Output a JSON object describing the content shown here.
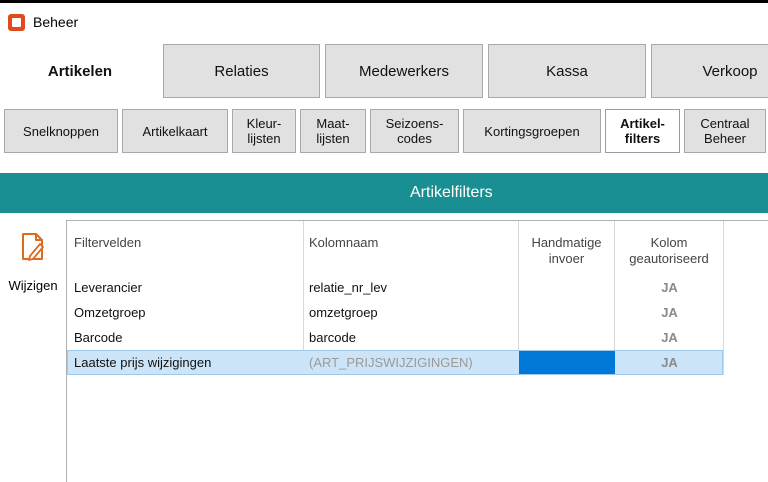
{
  "window": {
    "title": "Beheer"
  },
  "main_tabs": [
    {
      "label": "Artikelen",
      "active": true
    },
    {
      "label": "Relaties",
      "active": false
    },
    {
      "label": "Medewerkers",
      "active": false
    },
    {
      "label": "Kassa",
      "active": false
    },
    {
      "label": "Verkoop",
      "active": false
    }
  ],
  "sub_tabs": [
    {
      "label": "Snelknoppen",
      "active": false
    },
    {
      "label": "Artikelkaart",
      "active": false
    },
    {
      "label": "Kleur-\nlijsten",
      "active": false
    },
    {
      "label": "Maat-\nlijsten",
      "active": false
    },
    {
      "label": "Seizoens-\ncodes",
      "active": false
    },
    {
      "label": "Kortingsgroepen",
      "active": false
    },
    {
      "label": "Artikel-\nfilters",
      "active": true
    },
    {
      "label": "Centraal\nBeheer",
      "active": false
    }
  ],
  "section": {
    "title": "Artikelfilters",
    "color": "#1a8f93"
  },
  "toolbar": {
    "edit_label": "Wijzigen",
    "edit_icon": "edit-document-icon"
  },
  "grid": {
    "headers": {
      "filtervelden": "Filtervelden",
      "kolomnaam": "Kolomnaam",
      "handmatige": "Handmatige\ninvoer",
      "kolom": "Kolom\ngeautoriseerd"
    },
    "rows": [
      {
        "filterveld": "Leverancier",
        "kolomnaam": "relatie_nr_lev",
        "kolom": "JA"
      },
      {
        "filterveld": "Omzetgroep",
        "kolomnaam": "omzetgroep",
        "kolom": "JA"
      },
      {
        "filterveld": "Barcode",
        "kolomnaam": "barcode",
        "kolom": "JA"
      },
      {
        "filterveld": "Laatste prijs wijzigingen",
        "kolomnaam": "(ART_PRIJSWIJZIGINGEN)",
        "kolom": "JA"
      }
    ]
  }
}
